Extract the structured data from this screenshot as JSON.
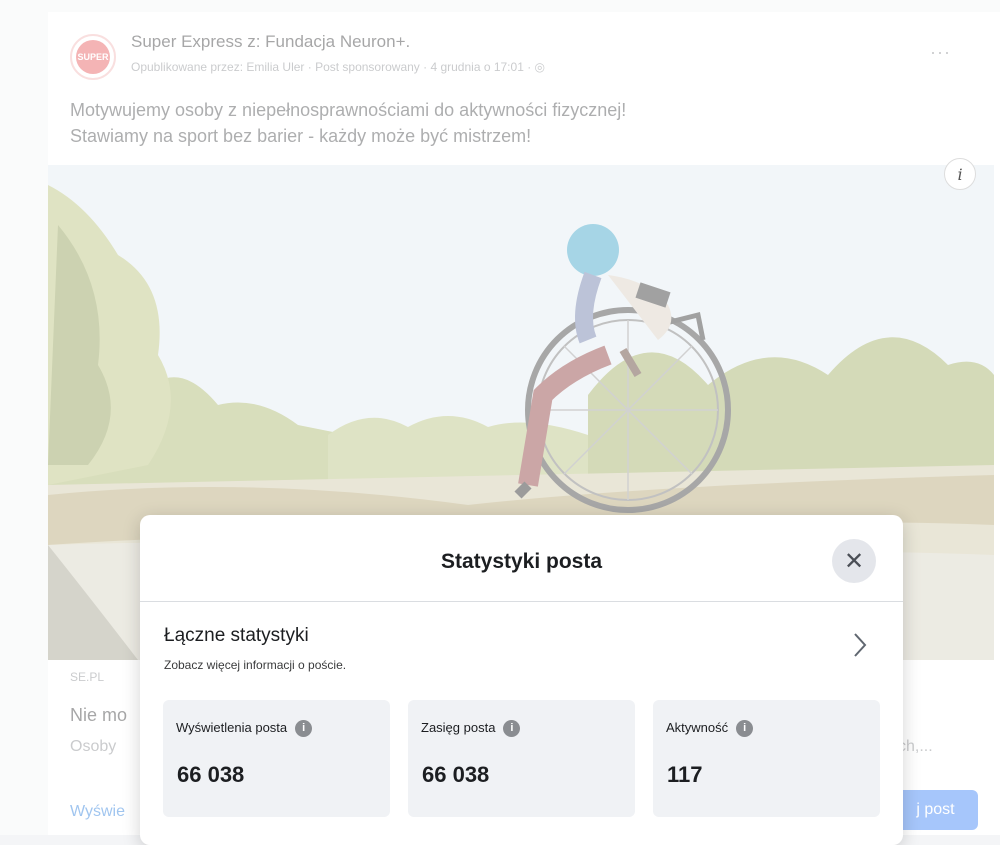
{
  "post": {
    "avatar_text": "SUPER",
    "page_name": "Super Express z: Fundacja Neuron+.",
    "meta": "Opublikowane przez: Emilia Uler · Post sponsorowany · 4 grudnia o 17:01 ·",
    "more_label": "···",
    "text_line1": "Motywujemy osoby z niepełnosprawnościami do aktywności fizycznej!",
    "text_line2": "Stawiamy na sport bez barier - każdy może być mistrzem!",
    "info_label": "i",
    "link_source": "SE.PL",
    "link_title": "Nie mo",
    "link_desc": "Osoby",
    "link_desc_tail": "ch,...",
    "show_link": "Wyświe",
    "boost_button": "j post"
  },
  "modal": {
    "title": "Statystyki posta",
    "close_label": "✕",
    "total_title": "Łączne statystyki",
    "total_subtitle": "Zobacz więcej informacji o poście.",
    "stats": [
      {
        "label": "Wyświetlenia posta",
        "value": "66 038"
      },
      {
        "label": "Zasięg posta",
        "value": "66 038"
      },
      {
        "label": "Aktywność",
        "value": "117"
      }
    ],
    "info_icon_glyph": "i"
  }
}
